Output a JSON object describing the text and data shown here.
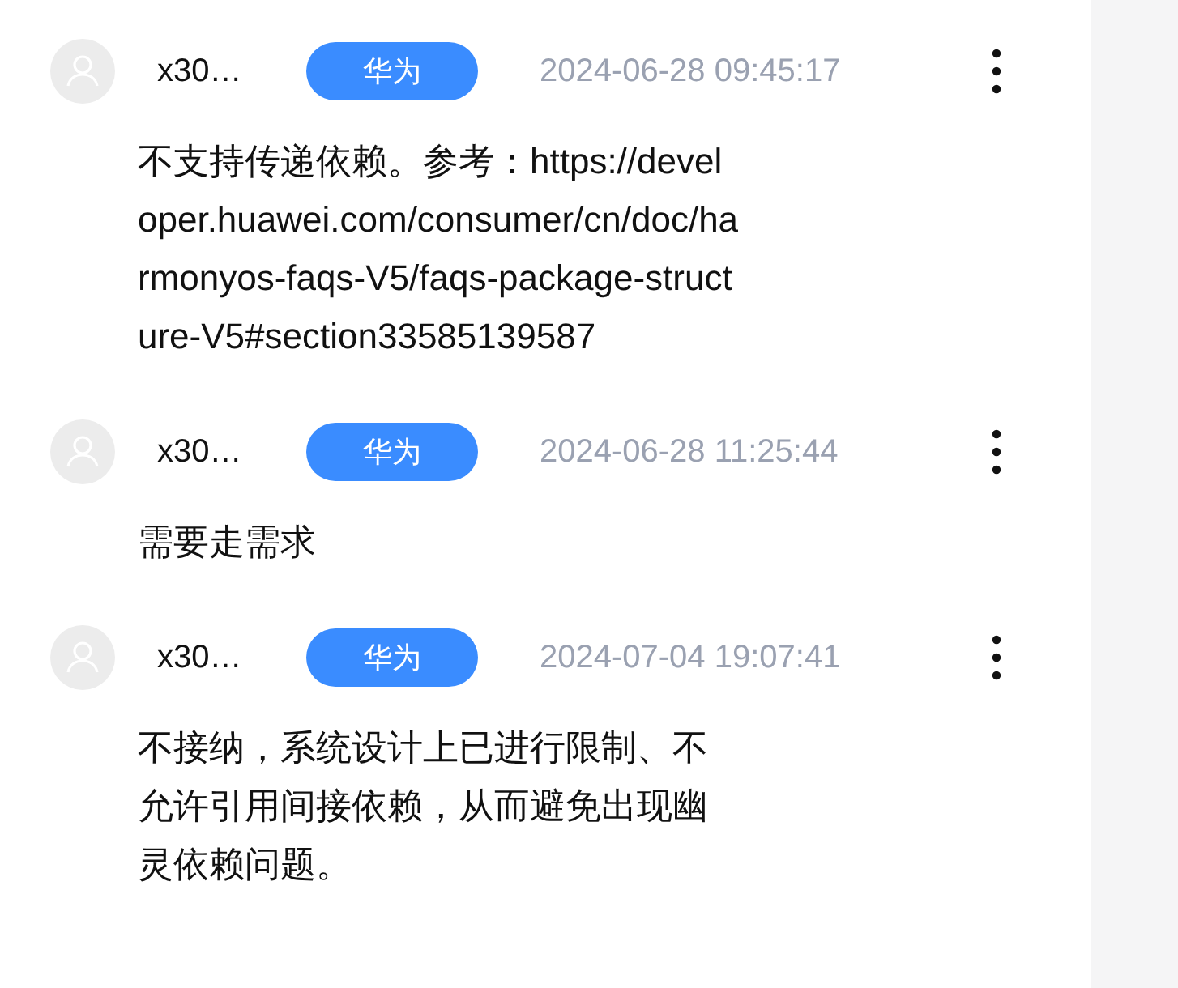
{
  "comments": [
    {
      "author": "x30…",
      "badge": "华为",
      "time": "2024-06-28 09:45:17",
      "text": "不支持传递依赖。参考：https://developer.huawei.com/consumer/cn/doc/harmonyos-faqs-V5/faqs-package-structure-V5#section33585139587"
    },
    {
      "author": "x30…",
      "badge": "华为",
      "time": "2024-06-28 11:25:44",
      "text": "需要走需求"
    },
    {
      "author": "x30…",
      "badge": "华为",
      "time": "2024-07-04 19:07:41",
      "text": "不接纳，系统设计上已进行限制、不允许引用间接依赖，从而避免出现幽灵依赖问题。"
    }
  ]
}
